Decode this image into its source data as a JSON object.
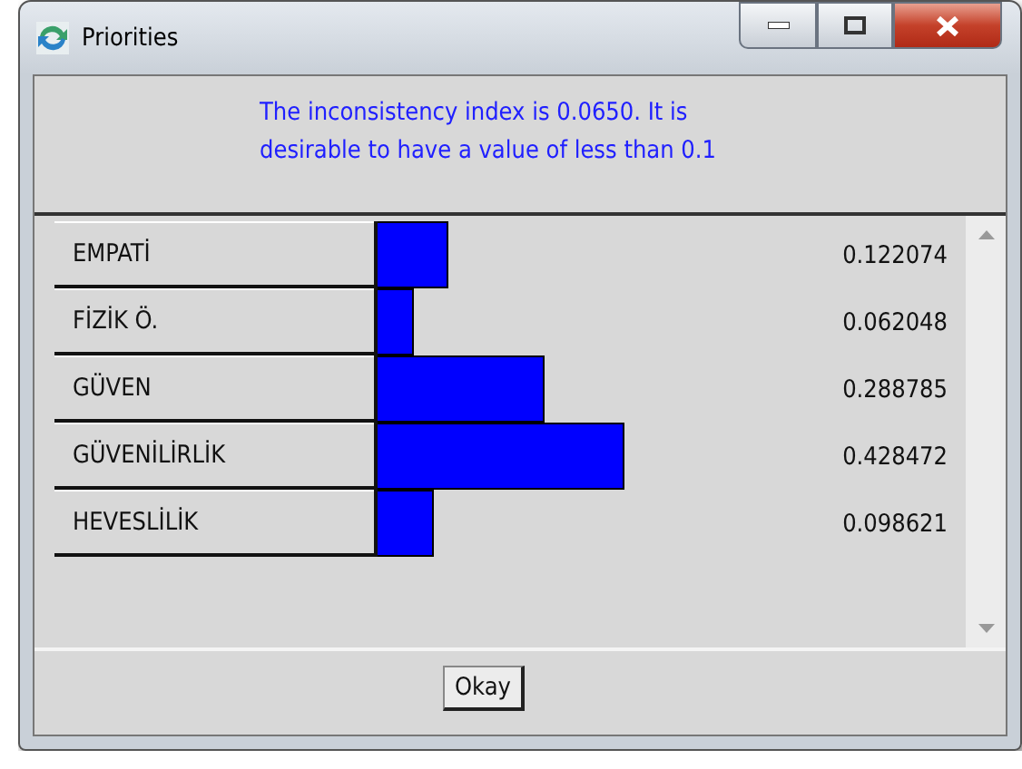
{
  "window": {
    "title": "Priorities"
  },
  "message": "The inconsistency index is 0.0650.  It is desirable to have a value of less than 0.1",
  "priorities": [
    {
      "label": "EMPATİ",
      "level": 0.122074,
      "value": "0.122074"
    },
    {
      "label": "FİZİK Ö.",
      "level": 0.062048,
      "value": "0.062048"
    },
    {
      "label": "GÜVEN",
      "level": 0.288785,
      "value": "0.288785"
    },
    {
      "label": "GÜVENİLİRLİK",
      "level": 0.428472,
      "value": "0.428472"
    },
    {
      "label": "HEVESLİLİK",
      "level": 0.098621,
      "value": "0.098621"
    }
  ],
  "buttons": [
    "Okay"
  ]
}
